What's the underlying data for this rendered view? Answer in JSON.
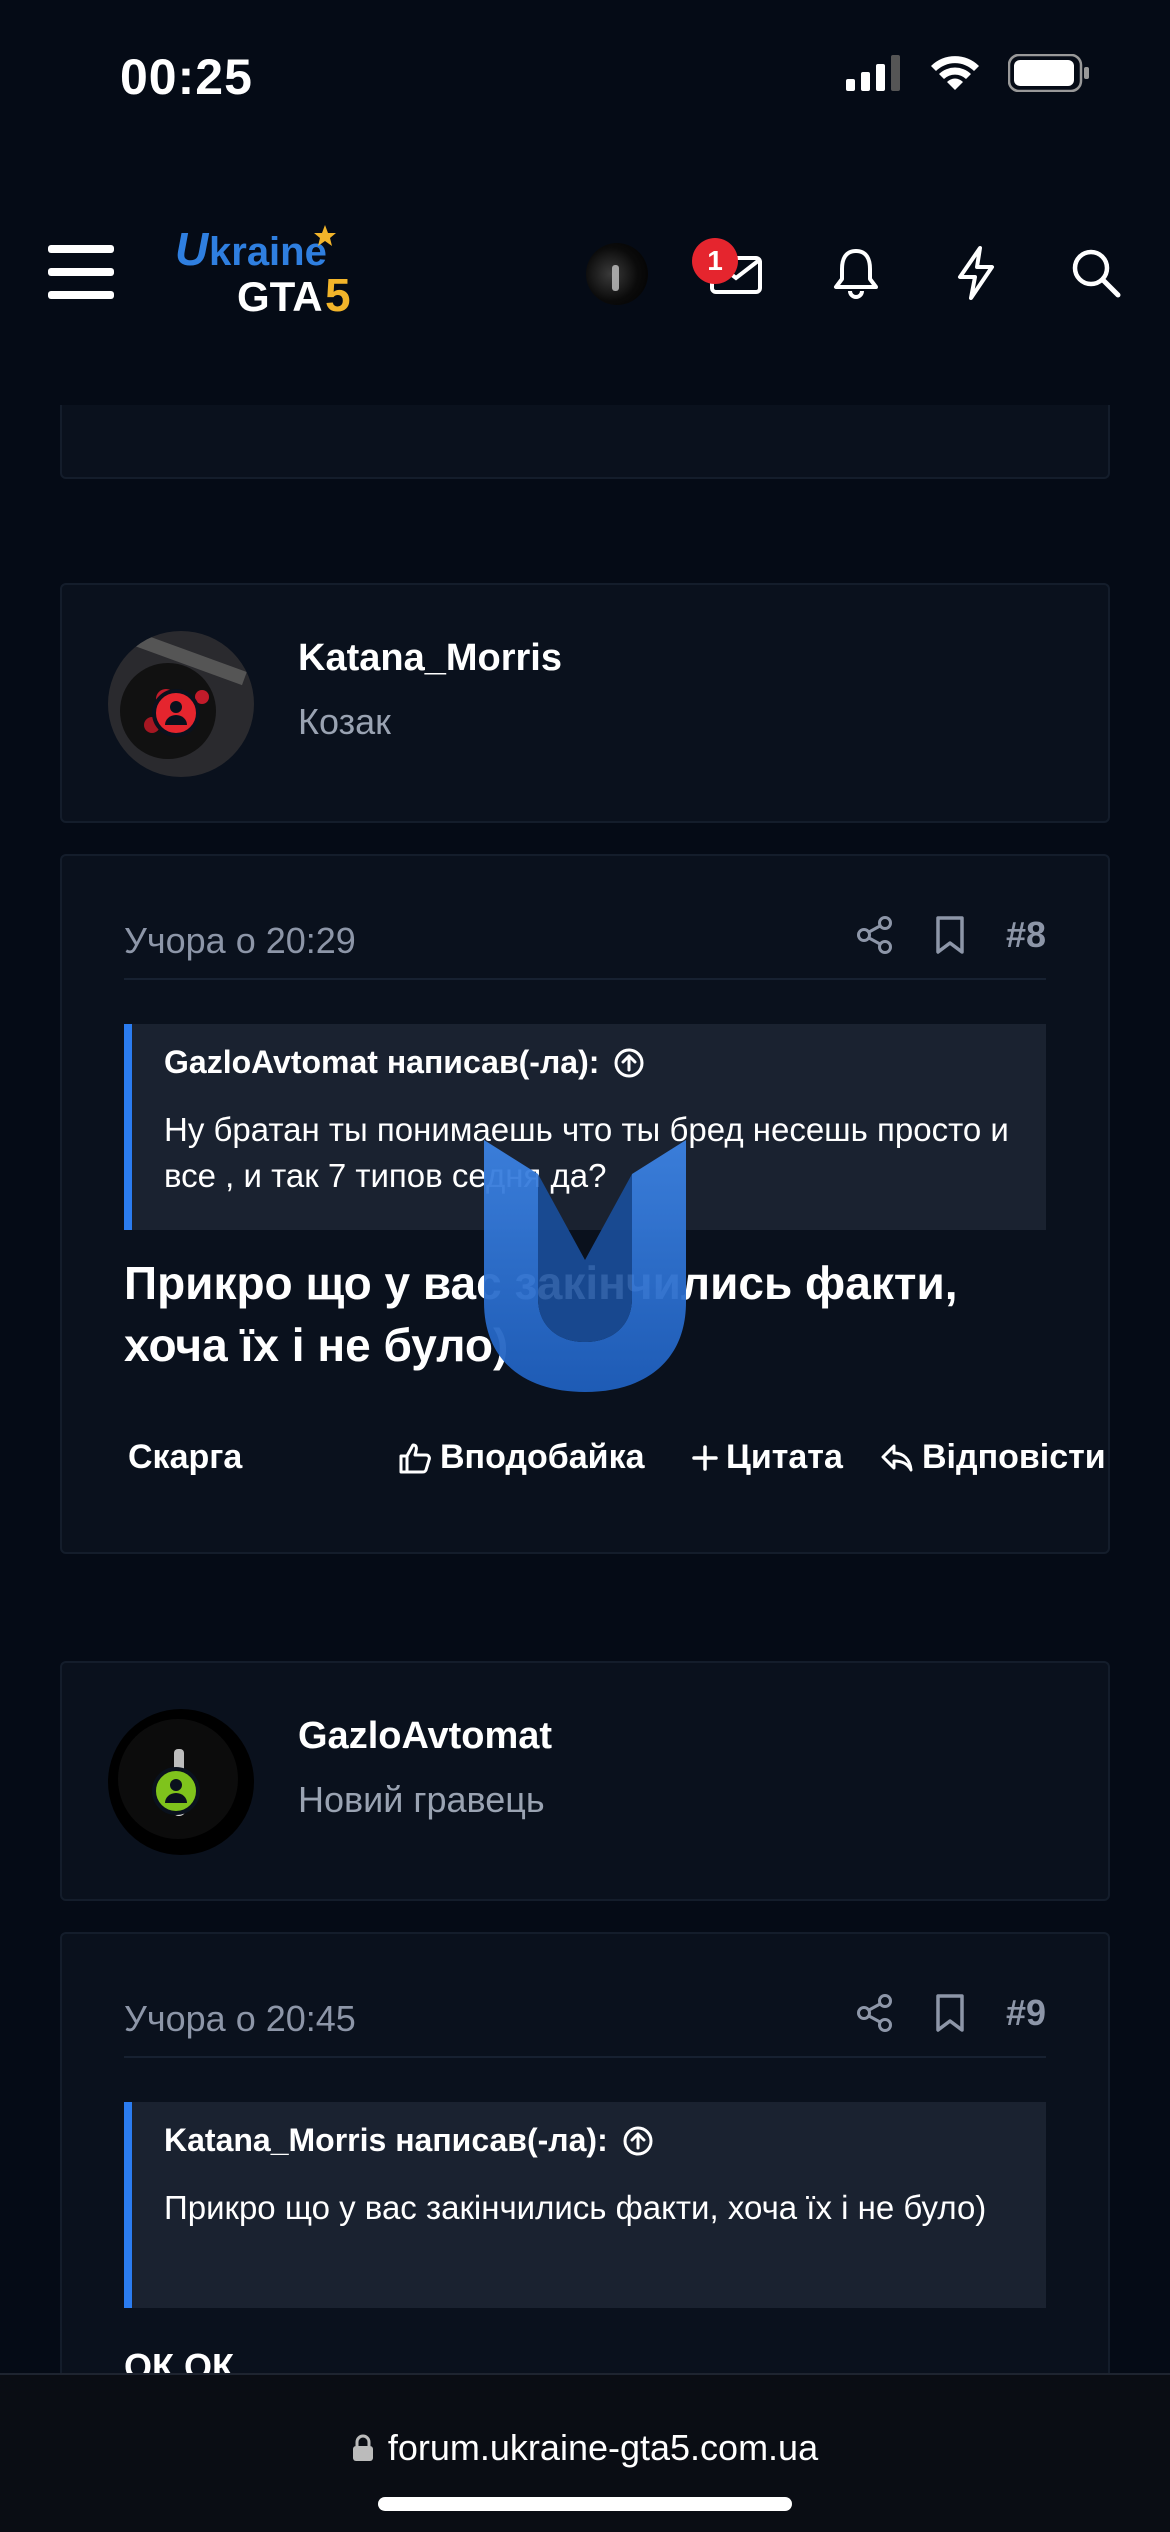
{
  "status_bar": {
    "time": "00:25"
  },
  "header": {
    "logo": {
      "line1": "Ukraine",
      "line2": "GTA",
      "line2_suffix": "5"
    },
    "notification_count": "1",
    "icons": [
      "menu-icon",
      "avatar",
      "mail-icon",
      "bell-icon",
      "lightning-icon",
      "search-icon"
    ]
  },
  "posts": [
    {
      "author": {
        "name": "Katana_Morris",
        "role": "Козак",
        "status_color": "#e5252e"
      },
      "date": "Учора о 20:29",
      "number": "#8",
      "quote": {
        "author": "GazloAvtomat написав(-ла):",
        "text": "Ну братан ты понимаешь что ты бред несешь просто и все , и так 7 типов седня да?"
      },
      "body": "Прикро що у вас закінчились факти, хоча їх і не було)",
      "actions": {
        "report": "Скарга",
        "like": "Вподобайка",
        "quote": "Цитата",
        "reply": "Відповісти"
      }
    },
    {
      "author": {
        "name": "GazloAvtomat",
        "role": "Новий гравець",
        "status_color": "#7fc31c"
      },
      "date": "Учора о 20:45",
      "number": "#9",
      "quote": {
        "author": "Katana_Morris написав(-ла):",
        "text": "Прикро що у вас закінчились факти, хоча їх і не було)"
      },
      "body": "ОК ОК"
    }
  ],
  "browser": {
    "url": "forum.ukraine-gta5.com.ua"
  },
  "colors": {
    "background": "#050b16",
    "card": "#0a111d",
    "accent": "#2b7cf0",
    "muted": "#8d96a8"
  }
}
